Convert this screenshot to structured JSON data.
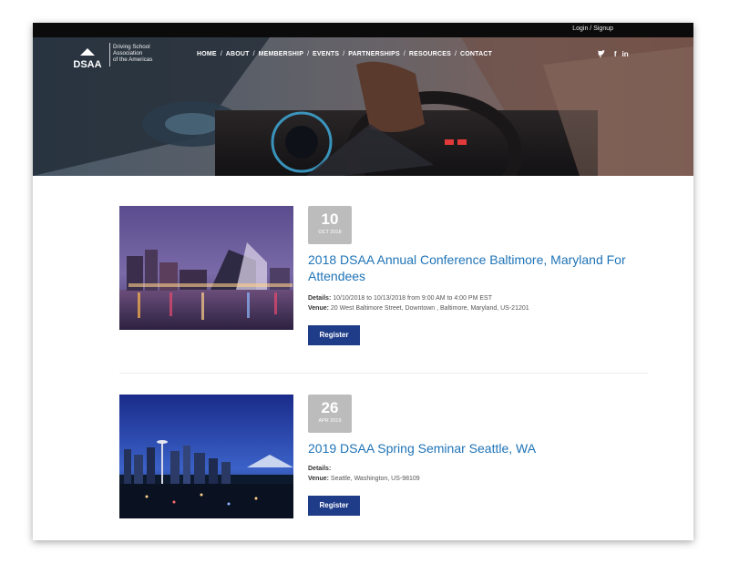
{
  "topbar": {
    "login_label": "Login / Signup"
  },
  "logo": {
    "text": "DSAA",
    "tagline": [
      "Driving School",
      "Association",
      "of the Americas"
    ]
  },
  "nav": {
    "items": [
      "HOME",
      "ABOUT",
      "MEMBERSHIP",
      "EVENTS",
      "PARTNERSHIPS",
      "RESOURCES",
      "CONTACT"
    ],
    "separator": "/"
  },
  "social": {
    "search_glyph": "⚲",
    "twitter_glyph": "🐦",
    "facebook_glyph": "f",
    "linkedin_glyph": "in"
  },
  "events": [
    {
      "day": "10",
      "month": "OCT 2018",
      "title": "2018 DSAA Annual Conference Baltimore, Maryland For Attendees",
      "details_label": "Details:",
      "details_value": "10/10/2018 to 10/13/2018 from 9:00 AM to 4:00 PM EST",
      "venue_label": "Venue:",
      "venue_value": "20 West Baltimore Street, Downtown , Baltimore, Maryland, US-21201",
      "register_label": "Register"
    },
    {
      "day": "26",
      "month": "APR 2019",
      "title": "2019 DSAA Spring Seminar Seattle, WA",
      "details_label": "Details:",
      "details_value": "",
      "venue_label": "Venue:",
      "venue_value": "Seattle, Washington, US-98109",
      "register_label": "Register"
    }
  ],
  "colors": {
    "accent": "#1e73b7",
    "button": "#1f3c88",
    "date_box": "#bcbcbc",
    "topbar": "#0b0b0b"
  }
}
